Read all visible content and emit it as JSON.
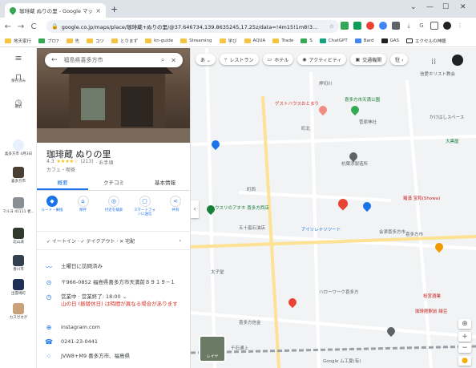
{
  "browser": {
    "tab_title": "珈琲蔵 ぬりの里 - Google マップ",
    "tab_close": "×",
    "new_tab": "+",
    "window_buttons": [
      "⌄",
      "—",
      "☐",
      "✕"
    ],
    "nav": [
      "←",
      "→",
      "C",
      "⌂"
    ],
    "url": "google.co.jp/maps/place/珈琲蔵+ぬりの里/@37.646734,139.8635245,17.25z/data=!4m15!1m8!3...",
    "bookmarks": [
      "地天家行",
      "プロ7",
      "先",
      "コツ",
      "とりまず",
      "kn-guide",
      "Streaming",
      "学び",
      "AQUA",
      "Trade",
      "S",
      "ChatGPT",
      "Bard",
      "GAS",
      "エクセルの神髄"
    ]
  },
  "rail": {
    "items": [
      {
        "icon": "menu-icon",
        "label": ""
      },
      {
        "icon": "bookmark-icon",
        "label": "保存済み"
      },
      {
        "icon": "history-icon",
        "label": "最近"
      },
      {
        "icon": "place-icon",
        "label": "喜多方市 4月3日"
      },
      {
        "icon": "thumb-icon",
        "label": "喜多方市"
      },
      {
        "icon": "thumb-icon",
        "label": "マルヨ 41111 者..."
      },
      {
        "icon": "thumb-icon",
        "label": "北山湯"
      },
      {
        "icon": "thumb-icon",
        "label": "香川市"
      },
      {
        "icon": "thumb-icon",
        "label": "出雲崎町"
      },
      {
        "icon": "thumb-icon",
        "label": "カスガカグ"
      }
    ]
  },
  "panel": {
    "search_text": "福島県喜多方市",
    "place_name": "珈琲蔵 ぬりの里",
    "rating_value": "4.3",
    "rating_stars": "★★★★☆",
    "review_count": "(213)",
    "price": "· お手頃",
    "category": "カフェ・喫茶",
    "tabs": [
      "概要",
      "クチコミ",
      "基本情報"
    ],
    "actions": [
      {
        "icon": "◆",
        "label": "ルート・乗換"
      },
      {
        "icon": "⌂",
        "label": "保存"
      },
      {
        "icon": "◎",
        "label": "付近を検索"
      },
      {
        "icon": "▢",
        "label": "スマートフォンに送信"
      },
      {
        "icon": "<",
        "label": "共有"
      }
    ],
    "services": "✓ イートイン · ✓ テイクアウト · ✕ 宅配",
    "services_chevron": "›",
    "info": [
      {
        "icon": "〰",
        "text": "土曜日に訪問済み"
      },
      {
        "icon": "⊙",
        "text": "〒966-0852 福島県喜多方市天満前８９１９−１"
      },
      {
        "icon": "◷",
        "text": "営業中 · 営業終了: 18:00 ⌄",
        "note": "山の日 (振替休日) は時間が異なる場合があります"
      },
      {
        "icon": "⊕",
        "text": "instagram.com"
      },
      {
        "icon": "☎",
        "text": "0241-23-0441"
      },
      {
        "icon": "⁘",
        "text": "JVW8+M9 喜多方市、福島県"
      }
    ]
  },
  "map": {
    "chips": [
      "あ ⌄",
      "レストラン",
      "ホテル",
      "アクティビティ",
      "交通機関",
      "駐 ›"
    ],
    "labels": [
      {
        "text": "ゲストハウスおとまり",
        "color": "#d93025"
      },
      {
        "text": "喜多方市天満公園",
        "color": "#188038"
      },
      {
        "text": "菅原神社",
        "color": "#5f6368"
      },
      {
        "text": "町北",
        "color": "#5f6368"
      },
      {
        "text": "杭葉添製造所",
        "color": "#5f6368"
      },
      {
        "text": "町西",
        "color": "#5f6368"
      },
      {
        "text": "ウスリのアオキ 喜多方西店",
        "color": "#188038"
      },
      {
        "text": "五十嵐石油店",
        "color": "#5f6368"
      },
      {
        "text": "アイソレナソツート",
        "color": "#1a73e8"
      },
      {
        "text": "太子堂",
        "color": "#5f6368"
      },
      {
        "text": "ハローワーク喜多方",
        "color": "#5f6368"
      },
      {
        "text": "喜多方信金",
        "color": "#5f6368"
      },
      {
        "text": "会津喜多方市",
        "color": "#5f6368"
      },
      {
        "text": "珈琲館駅前 緑豆",
        "color": "#c5221f"
      },
      {
        "text": "桜宮酒業",
        "color": "#c5221f"
      },
      {
        "text": "羅漢 宝和(Showa)",
        "color": "#c5221f"
      },
      {
        "text": "大黒屋",
        "color": "#188038"
      },
      {
        "text": "押切川",
        "color": "#5f6368"
      },
      {
        "text": "信愛キリスト教会",
        "color": "#5f6368"
      },
      {
        "text": "かけはしスペース",
        "color": "#5f6368"
      },
      {
        "text": "喜多方市",
        "color": "#5f6368"
      },
      {
        "text": "千石通上",
        "color": "#5f6368"
      },
      {
        "text": "Google ム工夏(有)",
        "color": "#5f6368"
      },
      {
        "text": "レイヤ",
        "color": "#ffffff"
      }
    ]
  }
}
